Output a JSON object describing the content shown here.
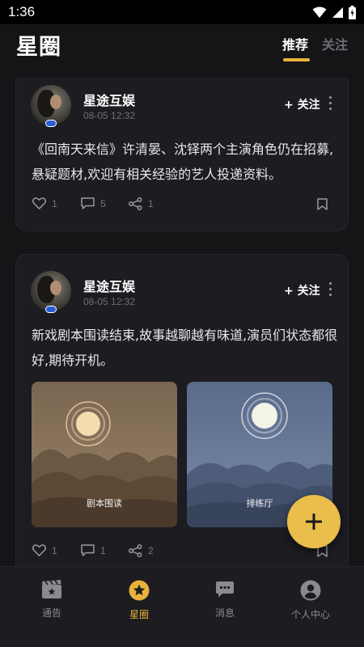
{
  "status_bar": {
    "time": "1:36"
  },
  "header": {
    "title": "星圈",
    "tabs": [
      {
        "label": "推荐",
        "active": true
      },
      {
        "label": "关注",
        "active": false
      }
    ]
  },
  "posts": [
    {
      "author": "星途互娱",
      "time": "08-05 12:32",
      "follow_label": "+ 关注",
      "text": "《回南天来信》许清晏、沈铎两个主演角色仍在招募,悬疑题材,欢迎有相关经验的艺人投递资料。",
      "likes": "1",
      "comments": "5",
      "shares": "1"
    },
    {
      "author": "星途互娱",
      "time": "08-05 12:32",
      "follow_label": "+ 关注",
      "text": "新戏剧本围读结束,故事越聊越有味道,演员们状态都很好,期待开机。",
      "images": [
        {
          "caption": "剧本围读"
        },
        {
          "caption": "排练厅"
        }
      ],
      "likes": "1",
      "comments": "1",
      "shares": "2"
    }
  ],
  "fab": {
    "icon": "plus-icon"
  },
  "bottom_nav": [
    {
      "label": "通告",
      "icon": "clapperboard-icon",
      "active": false
    },
    {
      "label": "星圈",
      "icon": "star-circle-icon",
      "active": true
    },
    {
      "label": "消息",
      "icon": "chat-bubble-icon",
      "active": false
    },
    {
      "label": "个人中心",
      "icon": "user-circle-icon",
      "active": false
    }
  ],
  "colors": {
    "background": "#151518",
    "card": "#1c1c21",
    "accent": "#e9b23b",
    "muted_text": "#6e6e74"
  }
}
